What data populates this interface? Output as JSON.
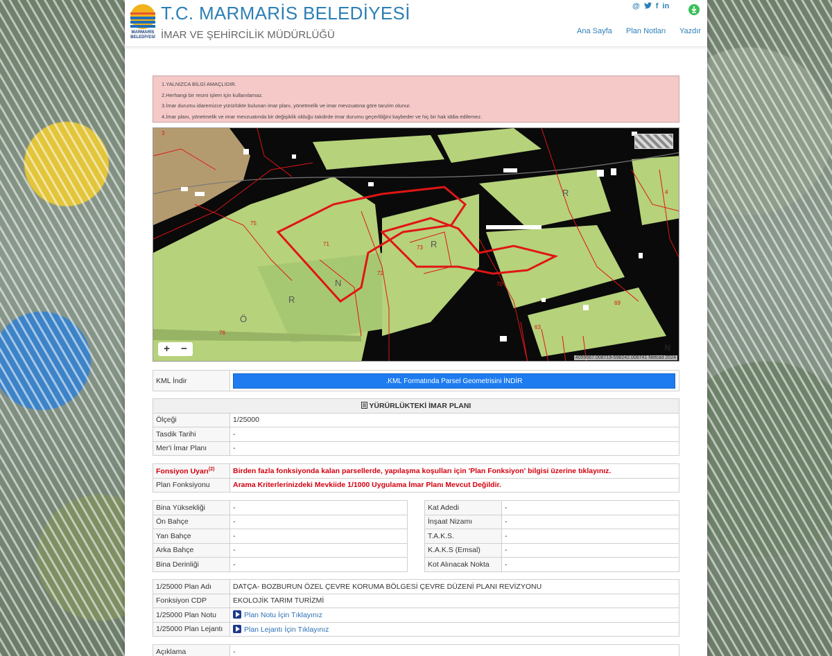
{
  "header": {
    "title": "T.C. MARMARİS BELEDİYESİ",
    "subtitle": "İMAR VE ŞEHİRCİLİK MÜDÜRLÜĞÜ",
    "logo_text_1": "MARMARİS",
    "logo_text_2": "BELEDİYESİ",
    "social_icons": [
      "@",
      "twitter-icon",
      "f",
      "in"
    ],
    "nav": [
      "Ana Sayfa",
      "Plan Notları",
      "Yazdır"
    ]
  },
  "warnings": [
    "1.YALNIZCA BİLGİ AMAÇLIDIR.",
    "2.Herhangi bir resmi işlem için kullanılamaz.",
    "3.İmar durumu idaremizce yürürlükte bulunan imar planı, yönetmelik ve imar mevzuatına göre tanzim olunur.",
    "4.İmar planı, yönetmelik ve imar mevzuatında bir değişiklik olduğu takdirde imar durumu geçerliliğini kaybeder ve hiç bir hak iddia edilemez."
  ],
  "map": {
    "zoom_in": "+",
    "zoom_out": "−",
    "attribution": "4059667.008719-598242.008741  Netcad 2024",
    "north": "N",
    "parcel_labels": [
      "3",
      "75",
      "71",
      "73",
      "72",
      "70",
      "69",
      "63",
      "76",
      "4"
    ],
    "letters": [
      "Ö",
      "R",
      "N",
      "R",
      "R"
    ]
  },
  "kml": {
    "label": "KML İndir",
    "button": ".KML Formatında Parsel Geometrisini İNDİR"
  },
  "plan": {
    "section_title": "YÜRÜRLÜKTEKİ İMAR PLANI",
    "rows": [
      {
        "label": "Ölçeği",
        "value": "1/25000"
      },
      {
        "label": "Tasdik Tarihi",
        "value": "-"
      },
      {
        "label": "Mer'i İmar Planı",
        "value": "-"
      }
    ]
  },
  "function": {
    "warn_label": "Fonsiyon Uyarı",
    "warn_sup": "(2)",
    "warn_text": "Birden fazla fonksiyonda kalan parsellerde, yapılaşma koşulları için 'Plan Fonksiyon' bilgisi üzerine tıklayınız.",
    "plan_label": "Plan Fonksiyonu",
    "plan_text": "Arama Kriterlerinizdeki Mevkiide 1/1000 Uygulama İmar Planı Mevcut Değildir."
  },
  "building_left": [
    {
      "label": "Bina Yüksekliği",
      "value": "-"
    },
    {
      "label": "Ön Bahçe",
      "value": "-"
    },
    {
      "label": "Yan Bahçe",
      "value": "-"
    },
    {
      "label": "Arka Bahçe",
      "value": "-"
    },
    {
      "label": "Bina Derinliği",
      "value": "-"
    }
  ],
  "building_right": [
    {
      "label": "Kat Adedi",
      "value": "-"
    },
    {
      "label": "İnşaat Nizamı",
      "value": "-"
    },
    {
      "label": "T.A.K.S.",
      "value": "-"
    },
    {
      "label": "K.A.K.S (Emsal)",
      "value": "-"
    },
    {
      "label": "Kot Alınacak Nokta",
      "value": "-"
    }
  ],
  "plan25000": {
    "name_label": "1/25000 Plan Adı",
    "name_value": "DATÇA- BOZBURUN ÖZEL ÇEVRE KORUMA BÖLGESİ ÇEVRE DÜZENİ PLANI REVİZYONU",
    "cdp_label": "Fonksiyon CDP",
    "cdp_value": "EKOLOJİK TARIM TURİZMİ",
    "note_label": "1/25000 Plan Notu",
    "note_link": "Plan Notu İçin Tıklayınız",
    "legend_label": "1/25000 Plan Lejantı",
    "legend_link": "Plan Lejantı İçin Tıklayınız"
  },
  "explanation": {
    "label": "Açıklama",
    "value": "-"
  }
}
